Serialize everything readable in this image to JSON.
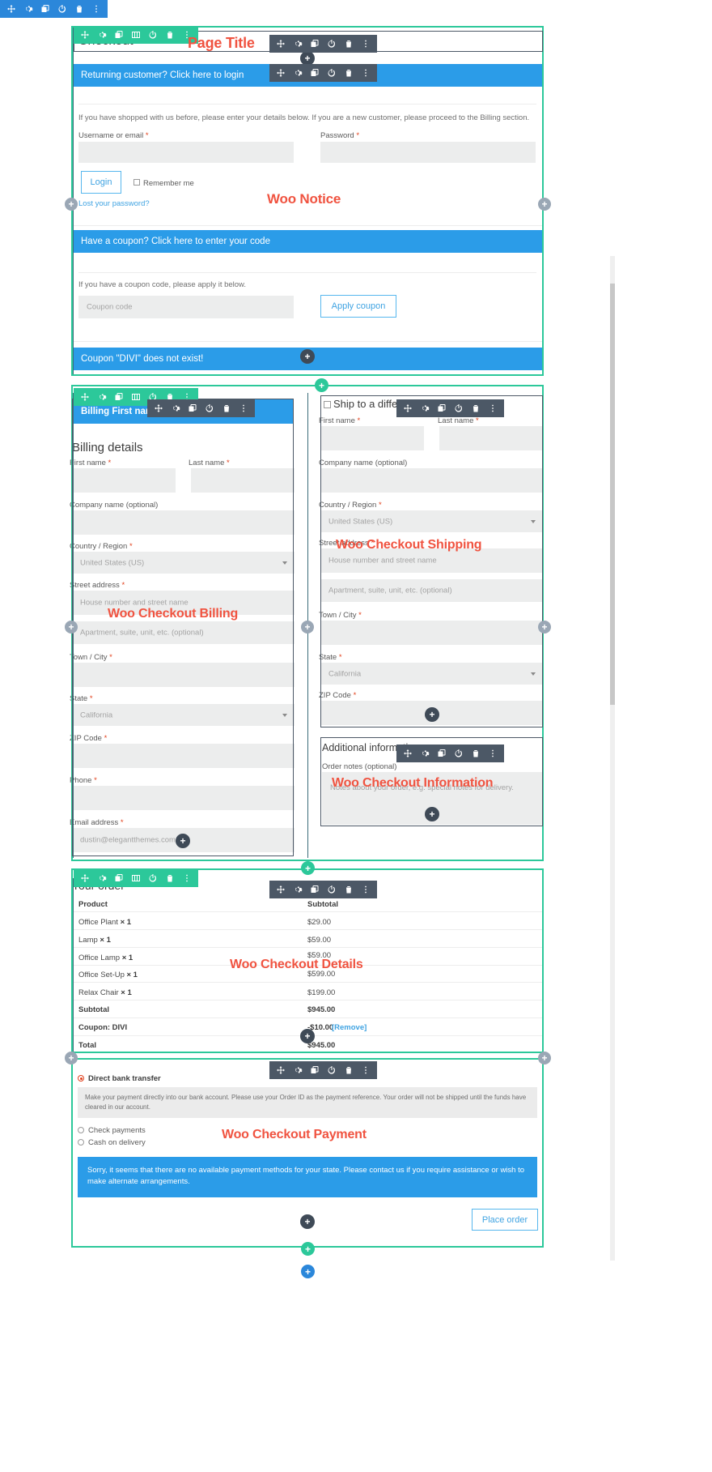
{
  "builder": {
    "toolbar_icons": [
      "move-icon",
      "gear-icon",
      "duplicate-icon",
      "columns-icon",
      "power-icon",
      "trash-icon",
      "more-options-icon"
    ],
    "module_toolbar_icons": [
      "move-icon",
      "gear-icon",
      "duplicate-icon",
      "power-icon",
      "trash-icon",
      "more-options-icon"
    ],
    "add_glyph": "+",
    "colors": {
      "section": "#2b87da",
      "row": "#2cc89a",
      "module": "#4c5866",
      "label": "#f05340"
    }
  },
  "module_labels": {
    "page_title": "Page Title",
    "woo_notice": "Woo Notice",
    "woo_checkout_billing": "Woo Checkout Billing",
    "woo_checkout_shipping": "Woo Checkout Shipping",
    "woo_checkout_information": "Woo Checkout Information",
    "woo_checkout_details": "Woo Checkout Details",
    "woo_checkout_payment": "Woo Checkout Payment"
  },
  "page": {
    "title": "Checkout"
  },
  "login": {
    "bar_text": "Returning customer? Click here to login",
    "intro": "If you have shopped with us before, please enter your details below. If you are a new customer, please proceed to the Billing section.",
    "username_label": "Username or email",
    "password_label": "Password",
    "login_button": "Login",
    "remember_label": "Remember me",
    "lost_password": "Lost your password?"
  },
  "coupon": {
    "bar_text": "Have a coupon? Click here to enter your code",
    "intro": "If you have a coupon code, please apply it below.",
    "input_placeholder": "Coupon code",
    "apply_button": "Apply coupon",
    "error_notice": "Coupon \"DIVI\" does not exist!"
  },
  "billing": {
    "bar_text": "Billing First name",
    "heading": "Billing details",
    "first_name": "First name",
    "last_name": "Last name",
    "company": "Company name (optional)",
    "country": "Country / Region",
    "country_value": "United States (US)",
    "street": "Street address",
    "street_ph": "House number and street name",
    "street2_ph": "Apartment, suite, unit, etc. (optional)",
    "city": "Town / City",
    "state": "State",
    "state_value": "California",
    "zip": "ZIP Code",
    "phone": "Phone",
    "email": "Email address",
    "email_ph": "dustin@elegantthemes.com"
  },
  "shipping": {
    "ship_diff_label": "Ship to a different address?",
    "first_name": "First name",
    "last_name": "Last name",
    "company": "Company name (optional)",
    "country": "Country / Region",
    "country_value": "United States (US)",
    "street": "Street address",
    "street_ph": "House number and street name",
    "street2_ph": "Apartment, suite, unit, etc. (optional)",
    "city": "Town / City",
    "state": "State",
    "state_value": "California",
    "zip": "ZIP Code"
  },
  "information": {
    "heading": "Additional information",
    "notes_label": "Order notes (optional)",
    "notes_ph": "Notes about your order, e.g. special notes for delivery."
  },
  "order": {
    "heading": "Your order",
    "col_product": "Product",
    "col_subtotal": "Subtotal",
    "items": [
      {
        "name": "Office Plant",
        "qty": "× 1",
        "price": "$29.00"
      },
      {
        "name": "Lamp",
        "qty": "× 1",
        "price": "$59.00"
      },
      {
        "name": "Office Lamp",
        "qty": "× 1",
        "price": "$59.00"
      },
      {
        "name": "Office Set-Up",
        "qty": "× 1",
        "price": "$599.00"
      },
      {
        "name": "Relax Chair",
        "qty": "× 1",
        "price": "$199.00"
      }
    ],
    "subtotal_label": "Subtotal",
    "subtotal_value": "$945.00",
    "coupon_label": "Coupon: DIVI",
    "coupon_value": "-$10.00",
    "coupon_remove": "[Remove]",
    "total_label": "Total",
    "total_value": "$945.00"
  },
  "payment": {
    "methods": [
      {
        "label": "Direct bank transfer",
        "selected": true
      },
      {
        "label": "Check payments",
        "selected": false
      },
      {
        "label": "Cash on delivery",
        "selected": false
      }
    ],
    "bank_description": "Make your payment directly into our bank account. Please use your Order ID as the payment reference. Your order will not be shipped until the funds have cleared in our account.",
    "error_notice": "Sorry, it seems that there are no available payment methods for your state. Please contact us if you require assistance or wish to make alternate arrangements.",
    "place_order_button": "Place order"
  }
}
